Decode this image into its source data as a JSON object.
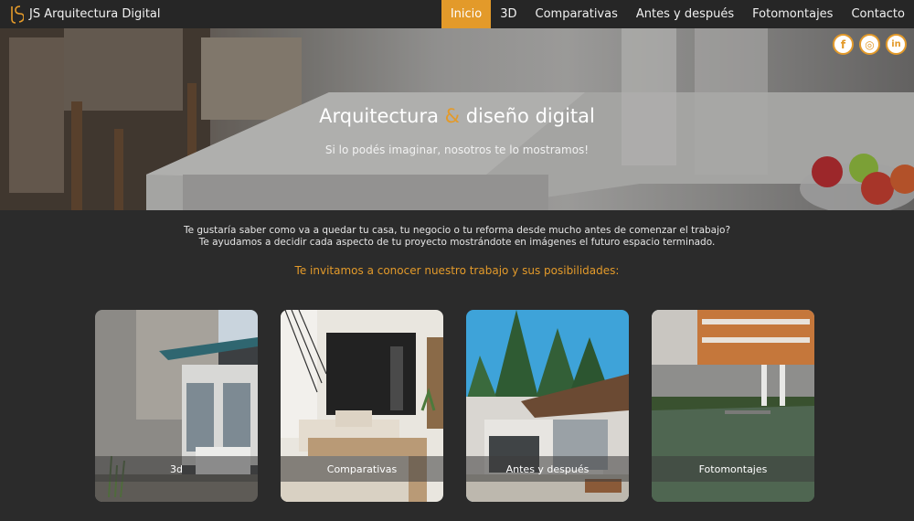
{
  "brand": {
    "title": "JS Arquitectura Digital"
  },
  "nav": [
    {
      "label": "Inicio",
      "active": true
    },
    {
      "label": "3D"
    },
    {
      "label": "Comparativas"
    },
    {
      "label": "Antes y después"
    },
    {
      "label": "Fotomontajes"
    },
    {
      "label": "Contacto"
    }
  ],
  "hero": {
    "title_part1": "Arquitectura ",
    "title_amp": "&",
    "title_part2": " diseño digital",
    "subtitle": "Si lo podés imaginar, nosotros te lo mostramos!"
  },
  "social": [
    {
      "icon": "facebook-icon",
      "glyph": "f"
    },
    {
      "icon": "instagram-icon",
      "glyph": "◎"
    },
    {
      "icon": "linkedin-icon",
      "glyph": "in"
    }
  ],
  "intro": {
    "line1": "Te gustaría saber como va a quedar tu casa, tu negocio o tu reforma desde mucho antes de comenzar el trabajo?",
    "line2": "Te ayudamos a decidir cada aspecto de tu proyecto mostrándote en imágenes el futuro espacio terminado."
  },
  "invite": "Te invitamos a conocer nuestro trabajo y sus posibilidades:",
  "cards": [
    {
      "label": "3d"
    },
    {
      "label": "Comparativas"
    },
    {
      "label": "Antes y después"
    },
    {
      "label": "Fotomontajes"
    }
  ],
  "colors": {
    "accent": "#e39a2a",
    "background": "#2b2b2b",
    "navbar": "#262626"
  }
}
